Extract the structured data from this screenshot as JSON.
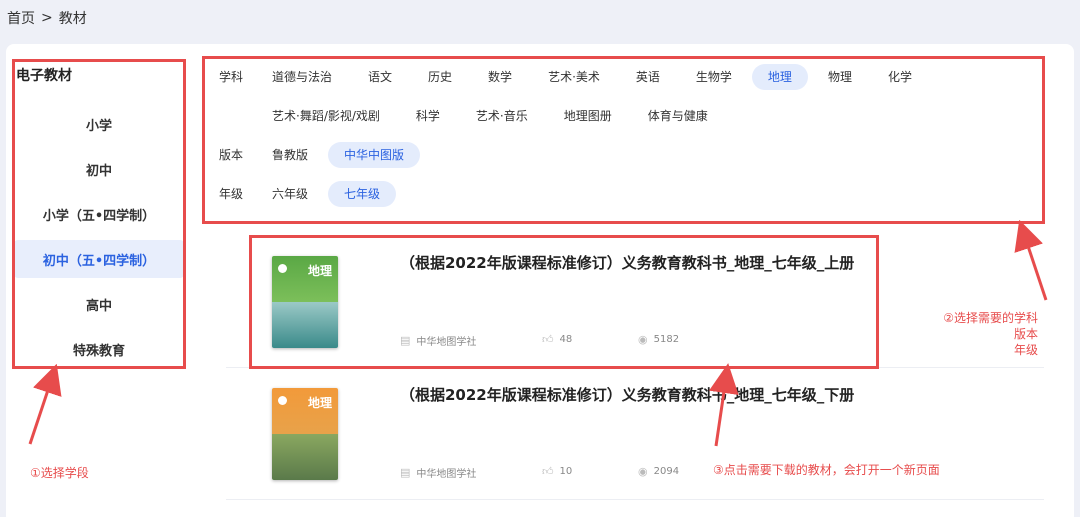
{
  "breadcrumb": {
    "home": "首页",
    "separator": ">",
    "current": "教材"
  },
  "sidebar": {
    "title": "电子教材",
    "stages": [
      {
        "label": "小学",
        "active": false
      },
      {
        "label": "初中",
        "active": false
      },
      {
        "label": "小学（五•四学制）",
        "active": false
      },
      {
        "label": "初中（五•四学制）",
        "active": true
      },
      {
        "label": "高中",
        "active": false
      },
      {
        "label": "特殊教育",
        "active": false
      }
    ]
  },
  "filters": {
    "subject": {
      "label": "学科",
      "options": [
        "道德与法治",
        "语文",
        "历史",
        "数学",
        "艺术·美术",
        "英语",
        "生物学",
        "地理",
        "物理",
        "化学",
        "艺术·舞蹈/影视/戏剧",
        "科学",
        "艺术·音乐",
        "地理图册",
        "体育与健康"
      ],
      "selected": "地理"
    },
    "edition": {
      "label": "版本",
      "options": [
        "鲁教版",
        "中华中图版"
      ],
      "selected": "中华中图版"
    },
    "grade": {
      "label": "年级",
      "options": [
        "六年级",
        "七年级"
      ],
      "selected": "七年级"
    }
  },
  "books": [
    {
      "title": "（根据2022年版课程标准修订）义务教育教科书_地理_七年级_上册",
      "cover_text": "地理",
      "publisher": "中华地图学社",
      "likes": "48",
      "views": "5182"
    },
    {
      "title": "（根据2022年版课程标准修订）义务教育教科书_地理_七年级_下册",
      "cover_text": "地理",
      "publisher": "中华地图学社",
      "likes": "10",
      "views": "2094"
    }
  ],
  "annotations": {
    "step1": "①选择学段",
    "step2_line1": "②选择需要的学科",
    "step2_line2": "版本",
    "step2_line3": "年级",
    "step3": "③点击需要下载的教材，会打开一个新页面"
  },
  "colors": {
    "accent": "#2b62e0",
    "accent_bg": "#e4ecfc",
    "annotation_red": "#e74c4c",
    "cover1_top": "#4f9e3e",
    "cover1_bottom": "#3a8a8a",
    "cover2_top": "#f08a2c",
    "cover2_bottom": "#6a8c4a"
  }
}
